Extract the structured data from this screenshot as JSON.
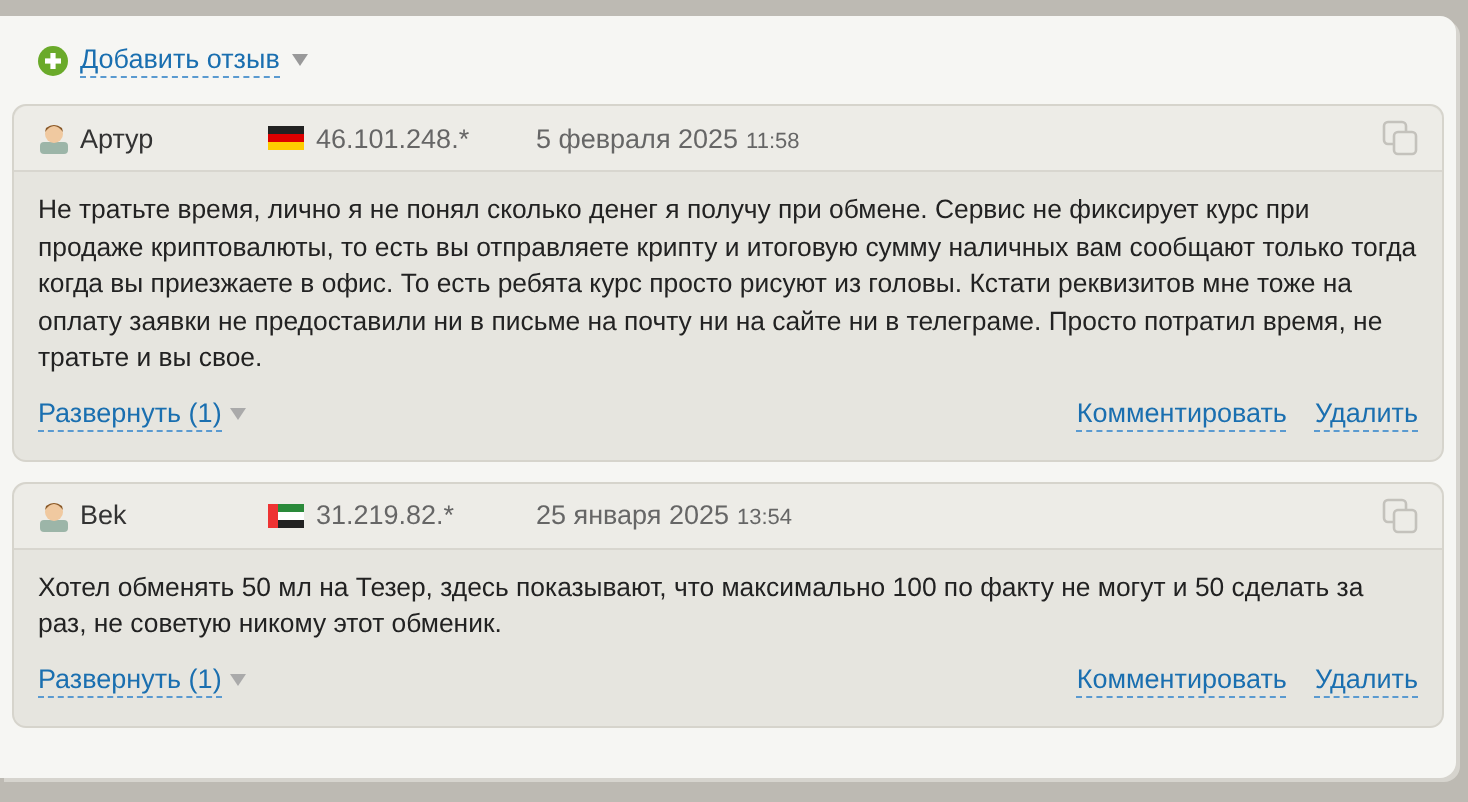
{
  "add_review": {
    "label": "Добавить отзыв"
  },
  "reviews": [
    {
      "author": "Артур",
      "kind": "de",
      "ip": "46.101.248.*",
      "date": "5 февраля 2025",
      "time": "11:58",
      "text": "Не тратьте время, лично я не понял сколько денег я получу при обмене. Сервис не фиксирует курс при продаже криптовалюты, то есть вы отправляете крипту и итоговую сумму наличных вам сообщают только тогда когда вы приезжаете в офис. То есть ребята курс просто рисуют из головы. Кстати реквизитов мне тоже на оплату заявки не предоставили ни в письме на почту ни на сайте ни в телеграме. Просто потратил время, не тратьте и вы свое.",
      "expand": "Развернуть (1)",
      "comment": "Комментировать",
      "delete": "Удалить"
    },
    {
      "author": "Bek",
      "kind": "ae",
      "ip": "31.219.82.*",
      "date": "25 января 2025",
      "time": "13:54",
      "text": "Хотел обменять 50 мл на Тезер, здесь показывают, что максимально 100 по факту не могут и 50 сделать за раз, не советую никому этот обменик.",
      "expand": "Развернуть (1)",
      "comment": "Комментировать",
      "delete": "Удалить"
    }
  ]
}
